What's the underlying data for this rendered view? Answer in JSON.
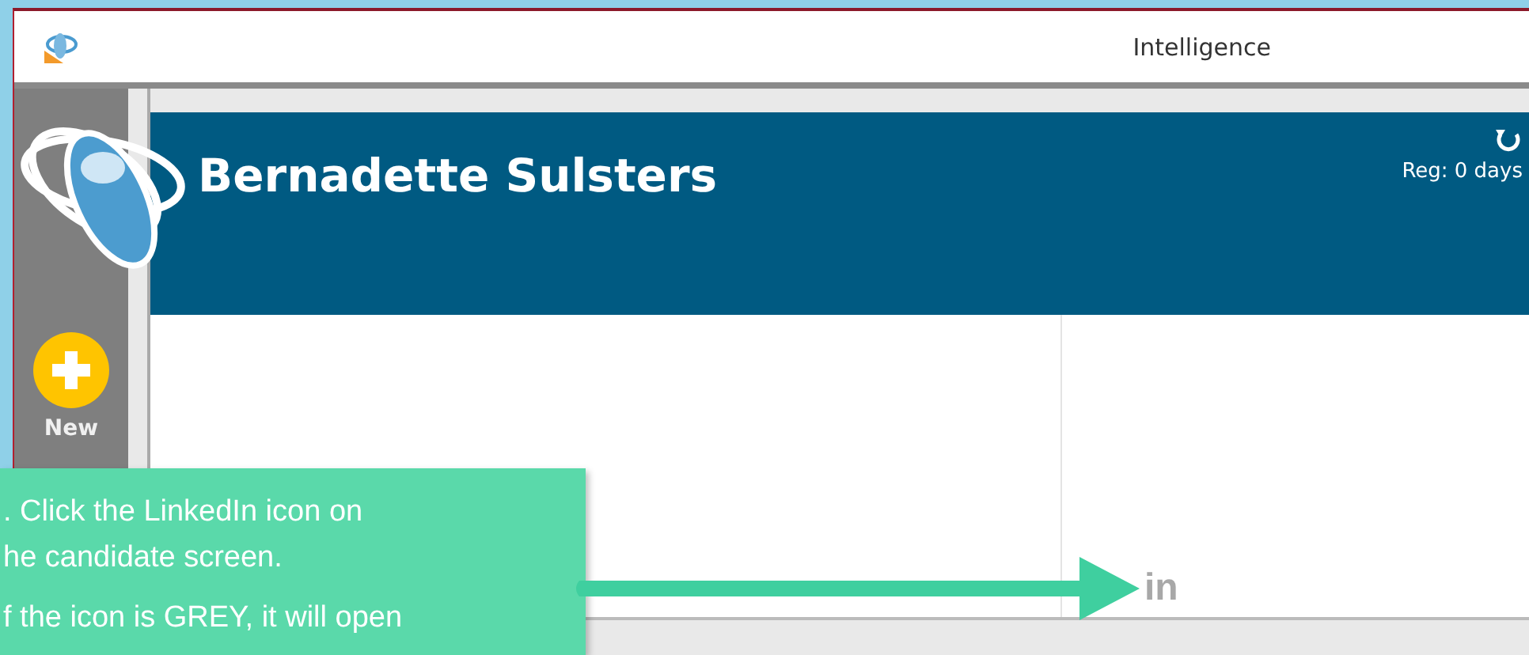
{
  "window": {
    "title": "Intelligence"
  },
  "sidebar": {
    "items": [
      {
        "label": "New"
      }
    ]
  },
  "header": {
    "name": "Bernadette Sulsters",
    "registered": "Reg: 0 days"
  },
  "linkedin": {
    "label": "in",
    "grey": true
  },
  "tooltip": {
    "paragraphs": [
      ". Click the LinkedIn icon on\nhe candidate screen.",
      "f the icon is GREY, it will open"
    ]
  }
}
